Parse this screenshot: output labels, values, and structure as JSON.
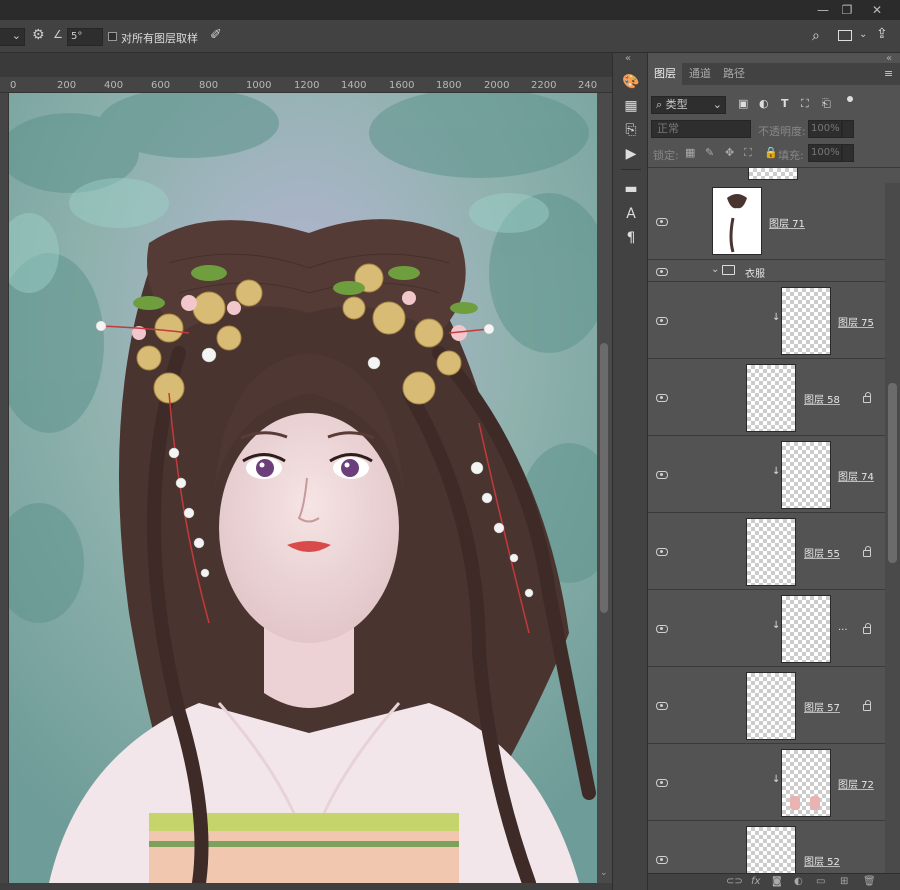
{
  "window": {
    "minimize_icon": "minimize-icon",
    "restore_icon": "restore-icon",
    "close_icon": "close-icon"
  },
  "options": {
    "angle_value": "5°",
    "sample_all_layers_label": "对所有图层取样"
  },
  "ruler": {
    "ticks": [
      "0",
      "200",
      "400",
      "600",
      "800",
      "1000",
      "1200",
      "1400",
      "1600",
      "1800",
      "2000",
      "2200",
      "240"
    ]
  },
  "panel": {
    "tabs": [
      "图层",
      "通道",
      "路径"
    ],
    "filter_kind": "类型",
    "blend_mode": "正常",
    "opacity_label": "不透明度:",
    "opacity_value": "100%",
    "lock_label": "锁定:",
    "fill_label": "填充:",
    "fill_value": "100%",
    "layers": [
      {
        "name": "图层 71",
        "locked": false,
        "clipped": false
      },
      {
        "name": "衣服",
        "group": true
      },
      {
        "name": "图层 75",
        "locked": false,
        "clipped": true
      },
      {
        "name": "图层 58",
        "locked": true,
        "clipped": false
      },
      {
        "name": "图层 74",
        "locked": false,
        "clipped": true
      },
      {
        "name": "图层 55",
        "locked": true,
        "clipped": false
      },
      {
        "name": "...",
        "locked": true,
        "clipped": true
      },
      {
        "name": "图层 57",
        "locked": true,
        "clipped": false
      },
      {
        "name": "图层 72",
        "locked": false,
        "clipped": true
      },
      {
        "name": "图层 52",
        "locked": false,
        "clipped": false
      }
    ]
  },
  "colors": {
    "accent": "#535353",
    "canvas_bg": "#8fb0ad"
  }
}
